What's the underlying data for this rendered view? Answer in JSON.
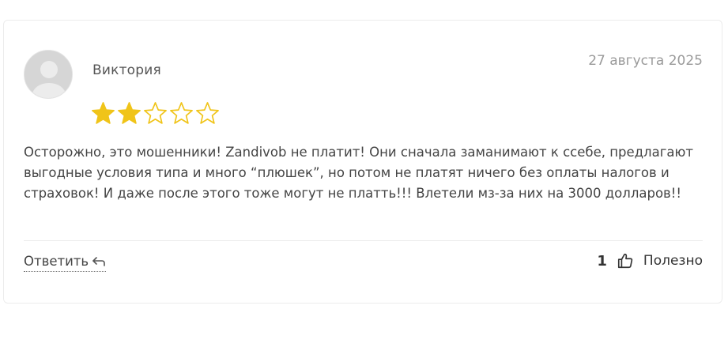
{
  "review": {
    "author": "Виктория",
    "date": "27 августа 2025",
    "rating": 2,
    "max_rating": 5,
    "star_color": "#f0c419",
    "text": "Осторожно, это мошенники! Zandivob не платит! Они сначала заманимают к ссебе, предлагают выгодные условия типа и много “плюшек”, но потом не платят ничего без оплаты налогов и страховок! И даже после этого тоже могут не платть!!! Влетели мз-за них на 3000 долларов!!",
    "reply_label": "Ответить",
    "helpful_count": "1",
    "helpful_label": "Полезно"
  },
  "icons": {
    "avatar": "user-placeholder-icon",
    "reply": "reply-arrow-icon",
    "thumb": "thumbs-up-icon",
    "star_filled": "star-filled-icon",
    "star_empty": "star-outline-icon"
  }
}
